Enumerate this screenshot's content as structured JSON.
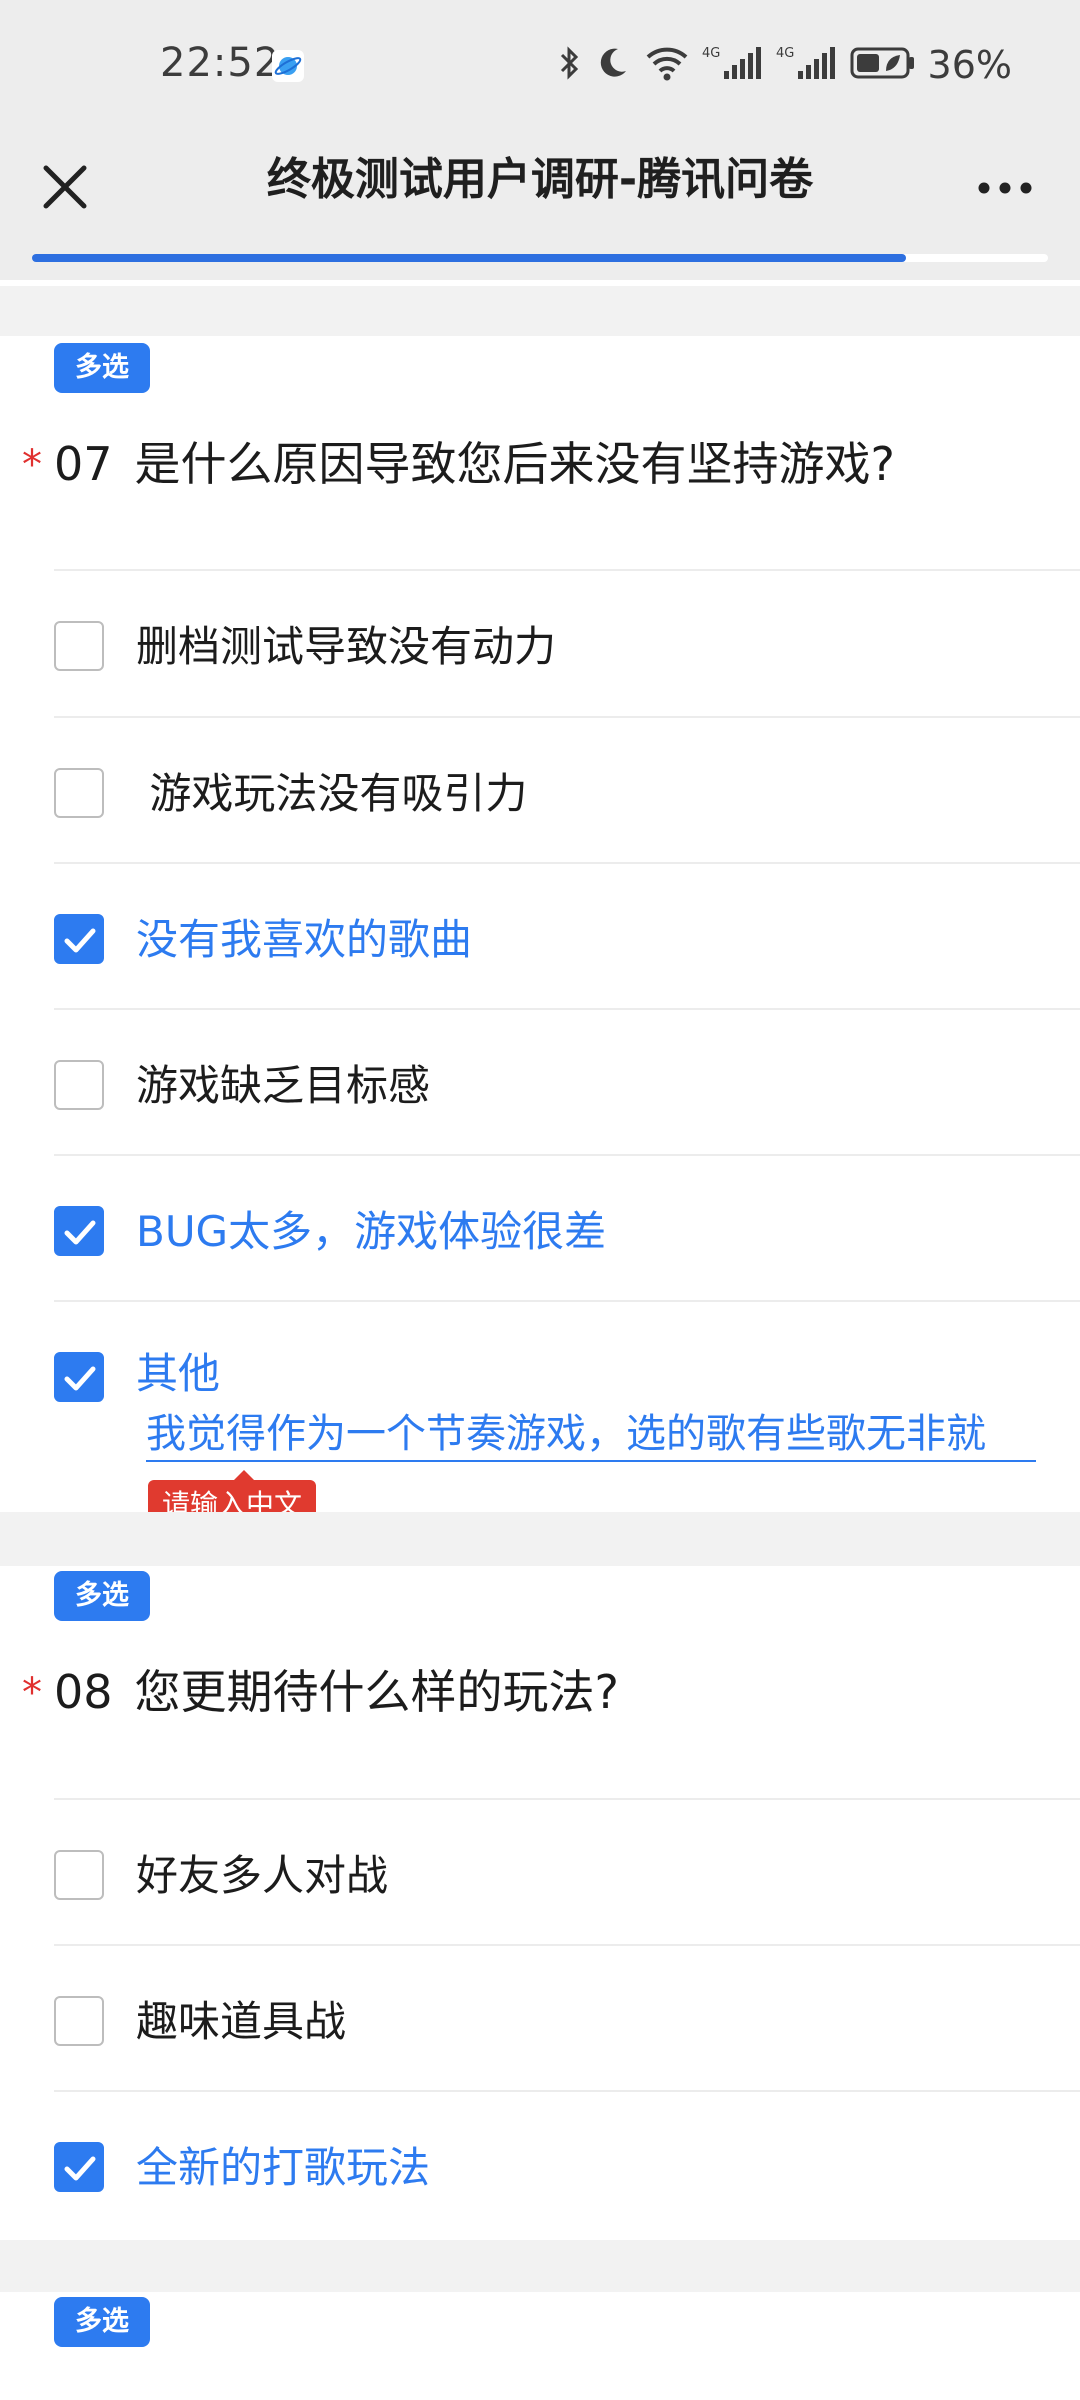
{
  "status_bar": {
    "time": "22:52",
    "battery_percent": "36%",
    "network_labels": [
      "4G",
      "4G"
    ],
    "icons": [
      "bluetooth-icon",
      "moon-icon",
      "wifi-icon",
      "signal-icon",
      "signal-icon",
      "battery-icon"
    ]
  },
  "header": {
    "title": "终极测试用户调研-腾讯问卷",
    "close_icon": "close-icon",
    "more_icon": "more-icon"
  },
  "progress": {
    "value": 0.86
  },
  "questions": [
    {
      "tag": "多选",
      "required_mark": "*",
      "number": "07",
      "title": "是什么原因导致您后来没有坚持游戏?",
      "options": [
        {
          "label": "删档测试导致没有动力",
          "checked": false
        },
        {
          "label": " 游戏玩法没有吸引力",
          "checked": false
        },
        {
          "label": "没有我喜欢的歌曲",
          "checked": true
        },
        {
          "label": "游戏缺乏目标感",
          "checked": false
        },
        {
          "label": "BUG太多，游戏体验很差",
          "checked": true
        },
        {
          "label": "其他",
          "checked": true
        }
      ],
      "other_input_value": "我觉得作为一个节奏游戏，选的歌有些歌无非就",
      "validation_message": "请输入中文"
    },
    {
      "tag": "多选",
      "required_mark": "*",
      "number": "08",
      "title": "您更期待什么样的玩法?",
      "options": [
        {
          "label": "好友多人对战",
          "checked": false
        },
        {
          "label": "趣味道具战",
          "checked": false
        },
        {
          "label": "全新的打歌玩法",
          "checked": true
        }
      ]
    },
    {
      "tag": "多选"
    }
  ],
  "colors": {
    "accent": "#2d7bf0",
    "required": "#e0302f",
    "error": "#e03a2f",
    "background_gray": "#f2f2f2"
  }
}
